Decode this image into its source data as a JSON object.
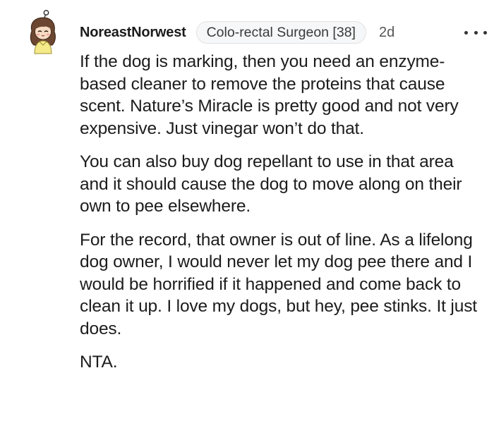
{
  "comment": {
    "username": "NoreastNorwest",
    "flair": "Colo-rectal Surgeon [38]",
    "timestamp": "2d",
    "more_icon": "more-horizontal-icon",
    "avatar_icon": "avatar-icon",
    "paragraphs": [
      "If the dog is marking, then you need an enzyme-based cleaner to remove the proteins that cause scent. Nature’s Miracle is pretty good and not very expensive. Just vinegar won’t do that.",
      "You can also buy dog repellant to use in that area and it should cause the dog to move along on their own to pee elsewhere.",
      "For the record, that owner is out of line. As a lifelong dog owner, I would never let my dog pee there and I would be horrified if it happened and come back to clean it up. I love my dogs, but hey, pee stinks. It just does.",
      "NTA."
    ]
  },
  "colors": {
    "text": "#1c1c1c",
    "flair_bg": "#f6f7f8",
    "flair_border": "#e2e2e2",
    "timestamp": "#555555"
  }
}
